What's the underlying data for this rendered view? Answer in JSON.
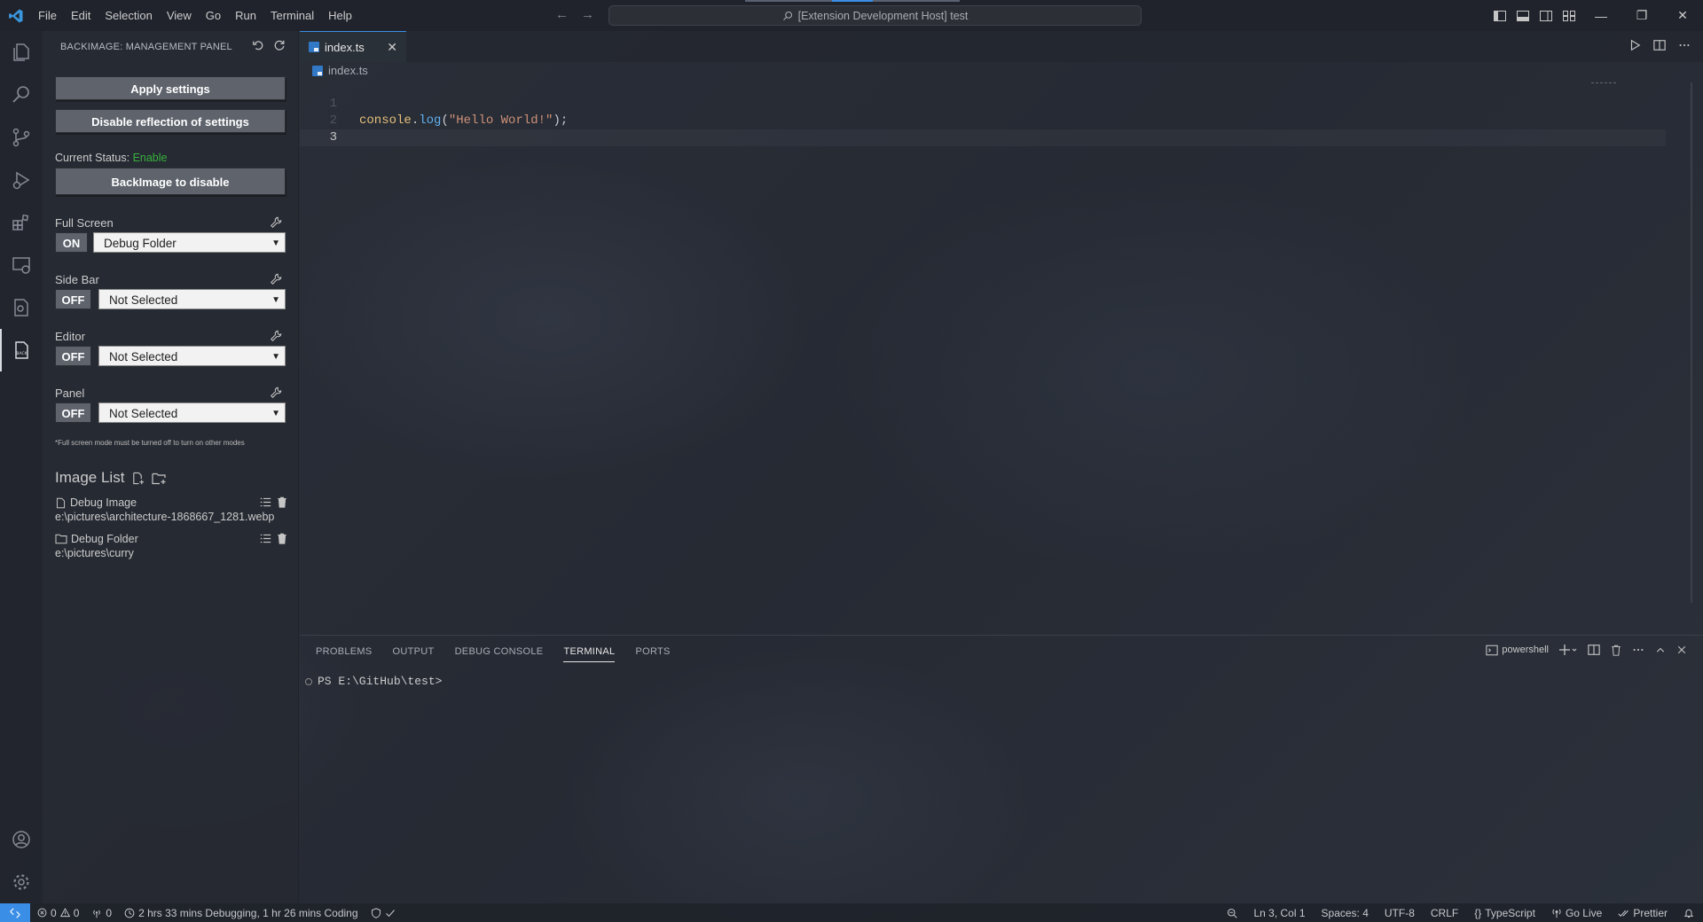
{
  "titlebar": {
    "menu": [
      "File",
      "Edit",
      "Selection",
      "View",
      "Go",
      "Run",
      "Terminal",
      "Help"
    ],
    "search_text": "[Extension Development Host] test"
  },
  "sidebar": {
    "title": "BACKIMAGE: MANAGEMENT PANEL",
    "apply_button": "Apply settings",
    "disable_reflection_button": "Disable reflection of settings",
    "status_label": "Current Status:",
    "status_value": "Enable",
    "backimage_disable_button": "BackImage to disable",
    "sections": [
      {
        "label": "Full Screen",
        "toggle": "ON",
        "select": "Debug Folder"
      },
      {
        "label": "Side Bar",
        "toggle": "OFF",
        "select": "Not Selected"
      },
      {
        "label": "Editor",
        "toggle": "OFF",
        "select": "Not Selected"
      },
      {
        "label": "Panel",
        "toggle": "OFF",
        "select": "Not Selected"
      }
    ],
    "note": "*Full screen mode must be turned off to turn on other modes",
    "image_list_title": "Image List",
    "images": [
      {
        "name": "Debug Image",
        "path": "e:\\pictures\\architecture-1868667_1281.webp"
      },
      {
        "name": "Debug Folder",
        "path": "e:\\pictures\\curry"
      }
    ]
  },
  "editor": {
    "tab_label": "index.ts",
    "breadcrumb": "index.ts",
    "line_numbers": [
      "1",
      "2",
      "3"
    ],
    "code_tokens": {
      "obj": "console",
      "dot": ".",
      "fn": "log",
      "open": "(",
      "str": "\"Hello World!\"",
      "close": ");"
    }
  },
  "panel": {
    "tabs": [
      "PROBLEMS",
      "OUTPUT",
      "DEBUG CONSOLE",
      "TERMINAL",
      "PORTS"
    ],
    "active_tab": "TERMINAL",
    "shell": "powershell",
    "prompt": "PS E:\\GitHub\\test>"
  },
  "statusbar": {
    "errors": "0",
    "warnings": "0",
    "ports": "0",
    "time_tracking": "2 hrs 33 mins Debugging, 1 hr 26 mins Coding",
    "position": "Ln 3, Col 1",
    "spaces": "Spaces: 4",
    "encoding": "UTF-8",
    "eol": "CRLF",
    "language": "TypeScript",
    "go_live": "Go Live",
    "prettier": "Prettier"
  },
  "colors": {
    "accent": "#3a8ee6",
    "status_enable": "#38b13b",
    "button_bg": "#5e636c"
  },
  "icons": {
    "activity": [
      "files-icon",
      "search-icon",
      "source-control-icon",
      "run-debug-icon",
      "extensions-icon",
      "remote-explorer-icon",
      "testing-icon",
      "backimage-icon"
    ],
    "activity_bottom": [
      "account-icon",
      "settings-gear-icon"
    ]
  }
}
